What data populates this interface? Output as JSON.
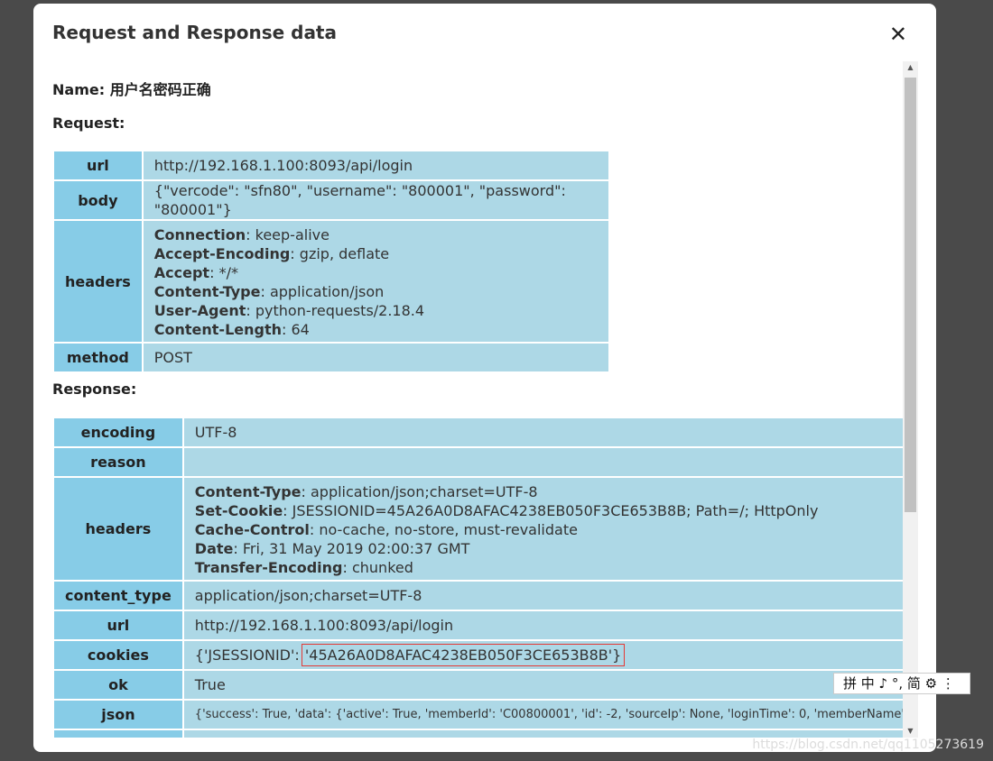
{
  "modal": {
    "title": "Request and Response data",
    "close_glyph": "✕"
  },
  "name": {
    "label": "Name:",
    "value": "用户名密码正确"
  },
  "request": {
    "label": "Request:",
    "url_key": "url",
    "url": "http://192.168.1.100:8093/api/login",
    "body_key": "body",
    "body": "{\"vercode\": \"sfn80\", \"username\": \"800001\", \"password\": \"800001\"}",
    "headers_key": "headers",
    "headers": [
      {
        "name": "Connection",
        "value": "keep-alive"
      },
      {
        "name": "Accept-Encoding",
        "value": "gzip, deflate"
      },
      {
        "name": "Accept",
        "value": "*/*"
      },
      {
        "name": "Content-Type",
        "value": "application/json"
      },
      {
        "name": "User-Agent",
        "value": "python-requests/2.18.4"
      },
      {
        "name": "Content-Length",
        "value": "64"
      }
    ],
    "method_key": "method",
    "method": "POST"
  },
  "response": {
    "label": "Response:",
    "encoding_key": "encoding",
    "encoding": "UTF-8",
    "reason_key": "reason",
    "reason": "",
    "headers_key": "headers",
    "headers": [
      {
        "name": "Content-Type",
        "value": "application/json;charset=UTF-8"
      },
      {
        "name": "Set-Cookie",
        "value": "JSESSIONID=45A26A0D8AFAC4238EB050F3CE653B8B; Path=/; HttpOnly"
      },
      {
        "name": "Cache-Control",
        "value": "no-cache, no-store, must-revalidate"
      },
      {
        "name": "Date",
        "value": "Fri, 31 May 2019 02:00:37 GMT"
      },
      {
        "name": "Transfer-Encoding",
        "value": "chunked"
      }
    ],
    "content_type_key": "content_type",
    "content_type": "application/json;charset=UTF-8",
    "url_key": "url",
    "url": "http://192.168.1.100:8093/api/login",
    "cookies_key": "cookies",
    "cookies_prefix": "{'JSESSIONID': ",
    "cookies_value": "'45A26A0D8AFAC4238EB050F3CE653B8B'}",
    "ok_key": "ok",
    "ok": "True",
    "json_key": "json",
    "json": "{'success': True, 'data': {'active': True, 'memberId': 'C00800001', 'id': -2, 'sourceIp': None, 'loginTime': 0, 'memberName': None, 'las"
  },
  "scrollbar": {
    "up_glyph": "▲",
    "down_glyph": "▼"
  },
  "ime": {
    "text": "拼 中 ♪ °, 简 ⚙ ⋮"
  },
  "watermark": "https://blog.csdn.net/qq1105273619"
}
